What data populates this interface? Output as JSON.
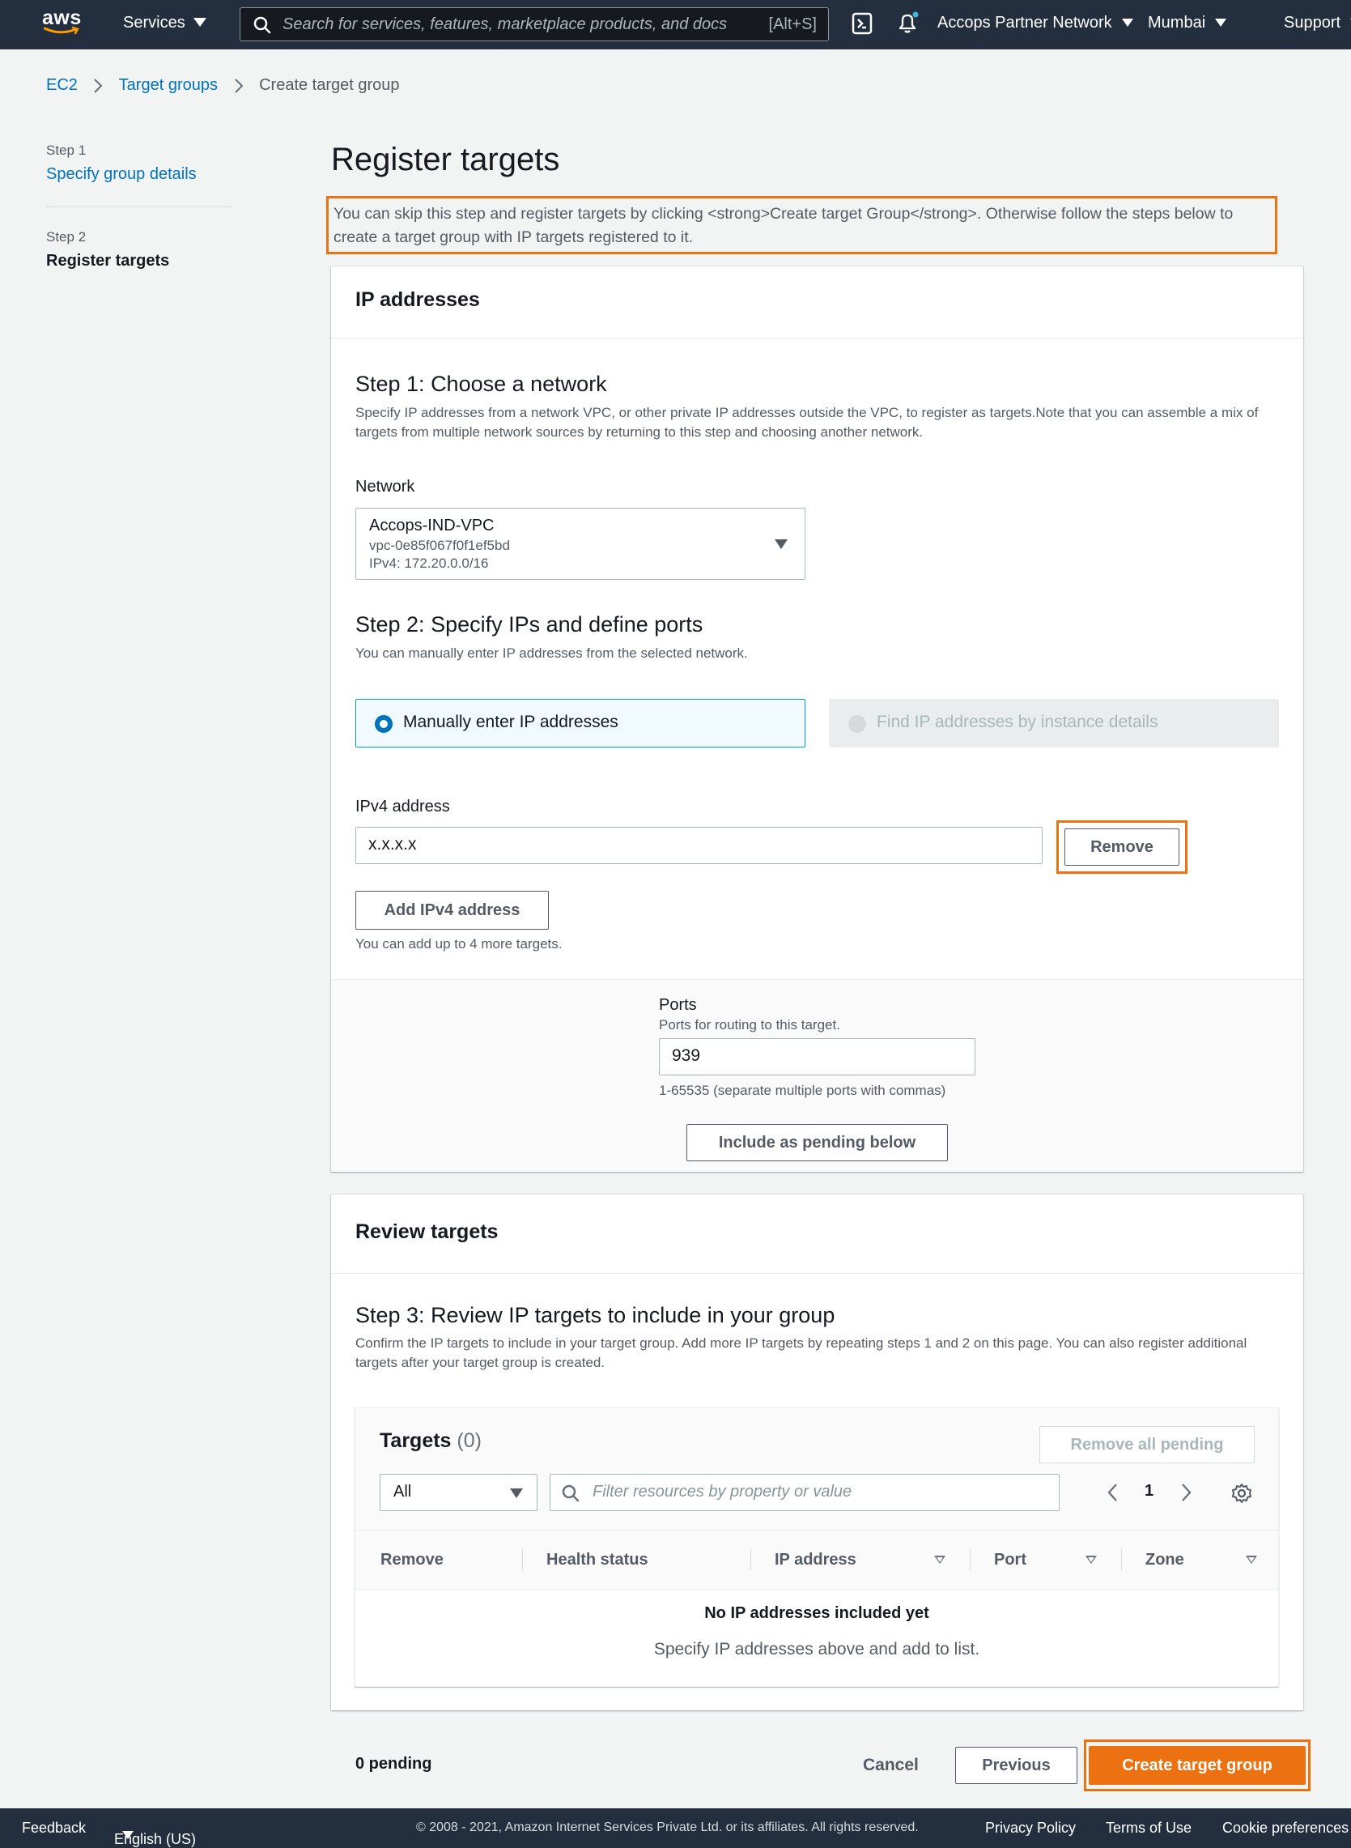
{
  "nav": {
    "logo": "aws",
    "services": "Services",
    "search_placeholder": "Search for services, features, marketplace products, and docs",
    "search_shortcut": "[Alt+S]",
    "account": "Accops Partner Network",
    "region": "Mumbai",
    "support": "Support",
    "icons": [
      "cloudshell-icon",
      "bell-icon"
    ]
  },
  "breadcrumb": [
    "EC2",
    "Target groups",
    "Create target group"
  ],
  "steps": [
    {
      "label": "Step 1",
      "title": "Specify group details"
    },
    {
      "label": "Step 2",
      "title": "Register targets"
    }
  ],
  "page": {
    "title": "Register targets",
    "description": "You can skip this step and register targets by clicking <strong>Create target Group</strong>. Otherwise follow the steps below to create a target group with IP targets registered to it."
  },
  "ip_section": {
    "header": "IP addresses",
    "step1_title": "Step 1: Choose a network",
    "step1_desc": "Specify IP addresses from a network VPC, or other private IP addresses outside the VPC, to register as targets.Note that you can assemble a mix of targets from multiple network sources by returning to this step and choosing another network.",
    "network_label": "Network",
    "network": {
      "name": "Accops-IND-VPC",
      "id": "vpc-0e85f067f0f1ef5bd",
      "cidr": "IPv4: 172.20.0.0/16"
    },
    "step2_title": "Step 2: Specify IPs and define ports",
    "step2_desc": "You can manually enter IP addresses from the selected network.",
    "option_manual": "Manually enter IP addresses",
    "option_find": "Find IP addresses by instance details",
    "ipv4_label": "IPv4 address",
    "ipv4_value": "x.x.x.x",
    "remove_button": "Remove",
    "add_button": "Add IPv4 address",
    "add_hint": "You can add up to 4 more targets.",
    "ports_label": "Ports",
    "ports_desc": "Ports for routing to this target.",
    "ports_value": "939",
    "ports_hint": "1-65535 (separate multiple ports with commas)",
    "include_button": "Include as pending below"
  },
  "review": {
    "header": "Review targets",
    "step3_title": "Step 3: Review IP targets to include in your group",
    "step3_desc": "Confirm the IP targets to include in your target group. Add more IP targets by repeating steps 1 and 2 on this page. You can also register additional targets after your target group is created.",
    "targets_title": "Targets",
    "targets_count": "(0)",
    "remove_all": "Remove all pending",
    "filter_select": "All",
    "filter_placeholder": "Filter resources by property or value",
    "page_number": "1",
    "columns": [
      "Remove",
      "Health status",
      "IP address",
      "Port",
      "Zone"
    ],
    "empty_title": "No IP addresses included yet",
    "empty_desc": "Specify IP addresses above and add to list."
  },
  "actions": {
    "pending": "0 pending",
    "cancel": "Cancel",
    "previous": "Previous",
    "create": "Create target group"
  },
  "footer": {
    "feedback": "Feedback",
    "language": "English (US)",
    "copyright": "© 2008 - 2021, Amazon Internet Services Private Ltd. or its affiliates. All rights reserved.",
    "privacy": "Privacy Policy",
    "terms": "Terms of Use",
    "cookies": "Cookie preferences"
  },
  "colors": {
    "nav_bg": "#232f3e",
    "link": "#0073bb",
    "accent": "#ec7211",
    "selected_tile_bg": "#f1faff"
  }
}
